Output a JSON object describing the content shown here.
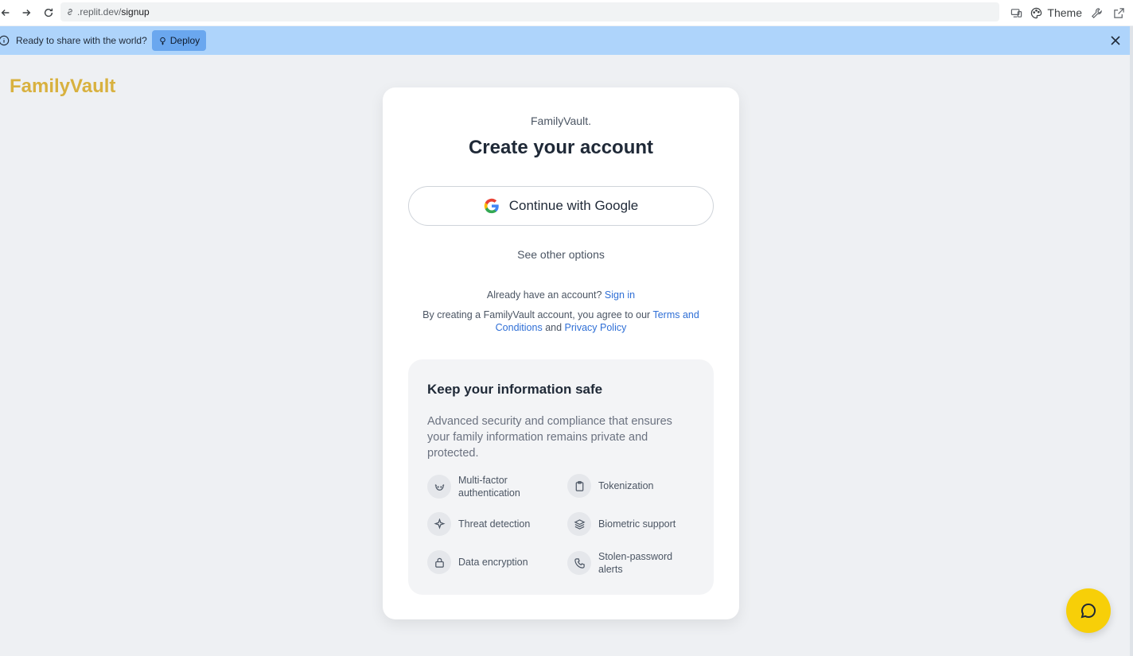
{
  "browser": {
    "url_host": ".replit.dev/",
    "url_path": "signup",
    "theme_label": "Theme"
  },
  "banner": {
    "text": "Ready to share with the world?",
    "deploy_label": "Deploy"
  },
  "brand": {
    "name": "FamilyVault"
  },
  "card": {
    "subtitle": "FamilyVault.",
    "title": "Create your account",
    "google_label": "Continue with Google",
    "other_options": "See other options",
    "already_text": "Already have an account?",
    "sign_in": "Sign in",
    "terms_prefix": "By creating a FamilyVault account, you agree to our",
    "terms_link": "Terms and Conditions",
    "terms_and": "and",
    "privacy_link": "Privacy Policy"
  },
  "safe": {
    "title": "Keep your information safe",
    "description": "Advanced security and compliance that ensures your family information remains private and protected.",
    "features": [
      {
        "label": "Multi-factor authentication",
        "icon": "smile-icon"
      },
      {
        "label": "Tokenization",
        "icon": "clipboard-icon"
      },
      {
        "label": "Threat detection",
        "icon": "sparkle-icon"
      },
      {
        "label": "Biometric support",
        "icon": "layers-icon"
      },
      {
        "label": "Data encryption",
        "icon": "lock-icon"
      },
      {
        "label": "Stolen-password alerts",
        "icon": "phone-icon"
      }
    ]
  },
  "colors": {
    "brand": "#d8b13f",
    "banner": "#aed4fb",
    "deploy": "#6aa7ef",
    "link": "#2f6fd6",
    "chat_fab": "#f7cf08"
  }
}
